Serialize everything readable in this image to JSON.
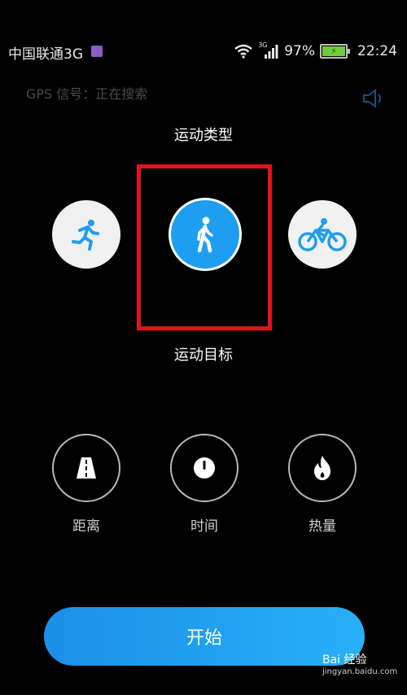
{
  "status_bar": {
    "carrier": "中国联通3G",
    "network": "3G",
    "battery": "97%",
    "time": "22:24",
    "icons": [
      "sim-badge-icon",
      "wifi-icon",
      "signal-icon",
      "battery-icon"
    ]
  },
  "gps": {
    "label": "GPS 信号：正在搜索"
  },
  "speaker_icon": "speaker-icon",
  "sport_type": {
    "title": "运动类型",
    "options": [
      {
        "icon": "running-icon",
        "selected": false
      },
      {
        "icon": "walking-icon",
        "selected": true
      },
      {
        "icon": "cycling-icon",
        "selected": false
      }
    ]
  },
  "goal": {
    "title": "运动目标",
    "options": [
      {
        "icon": "road-icon",
        "label": "距离"
      },
      {
        "icon": "clock-icon",
        "label": "时间"
      },
      {
        "icon": "flame-icon",
        "label": "热量"
      }
    ]
  },
  "start_button": {
    "label": "开始"
  },
  "watermark": {
    "brand": "Bai 经验",
    "url": "jingyan.baidu.com"
  },
  "colors": {
    "accent": "#1e9ef0",
    "highlight": "#e3121b",
    "background": "#000000"
  }
}
